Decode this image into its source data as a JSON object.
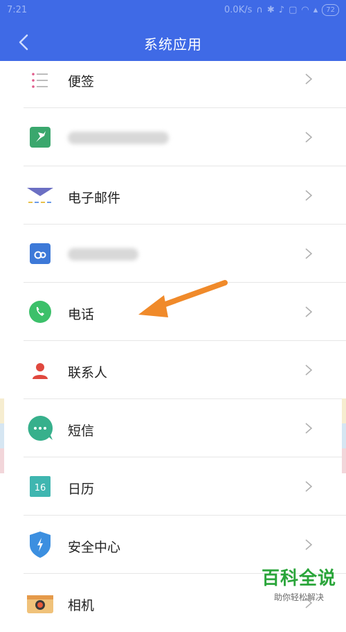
{
  "status_bar": {
    "time": "7:21",
    "speed": "0.0K/s",
    "battery": "72"
  },
  "header": {
    "title": "系统应用"
  },
  "items": [
    {
      "label": "便签",
      "icon": "notes-icon"
    },
    {
      "label": "",
      "icon": "hummingbird-app-icon",
      "blurred": true
    },
    {
      "label": "电子邮件",
      "icon": "email-icon"
    },
    {
      "label": "",
      "icon": "cloud-icon",
      "blurred": true
    },
    {
      "label": "电话",
      "icon": "phone-icon"
    },
    {
      "label": "联系人",
      "icon": "contacts-icon"
    },
    {
      "label": "短信",
      "icon": "messages-icon"
    },
    {
      "label": "日历",
      "icon": "calendar-icon",
      "calendar_day": "16"
    },
    {
      "label": "安全中心",
      "icon": "security-shield-icon"
    },
    {
      "label": "相机",
      "icon": "camera-icon"
    }
  ],
  "watermark": {
    "line1": "百科全说",
    "line2": "助你轻松解决"
  },
  "colors": {
    "header": "#3f6ae6",
    "annotation_arrow": "#f08a2a",
    "watermark": "#2aa53a"
  }
}
